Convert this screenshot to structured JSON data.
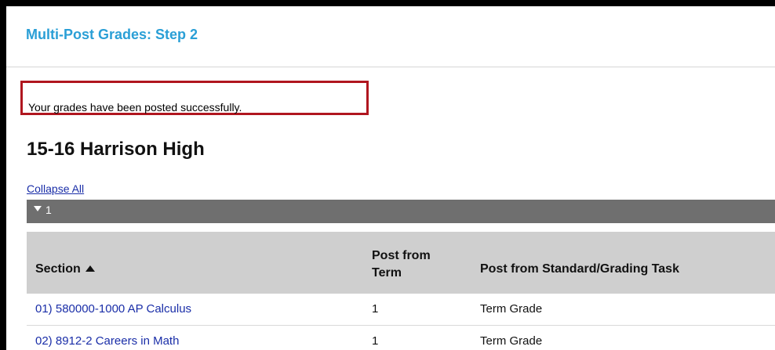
{
  "page": {
    "title": "Multi-Post Grades: Step 2",
    "success_message": "Your grades have been posted successfully.",
    "school_name": "15-16 Harrison High",
    "collapse_label": "Collapse All"
  },
  "group": {
    "label": "1",
    "icon": "triangle-down-icon"
  },
  "table": {
    "headers": {
      "section": "Section",
      "term_line1": "Post from",
      "term_line2": "Term",
      "task": "Post from Standard/Grading Task"
    },
    "sort_icon": "triangle-up-icon",
    "rows": [
      {
        "section": "01) 580000-1000 AP Calculus",
        "term": "1",
        "task": "Term Grade"
      },
      {
        "section": "02) 8912-2 Careers in Math",
        "term": "1",
        "task": "Term Grade"
      }
    ]
  },
  "colors": {
    "title": "#2a9fd6",
    "highlight_border": "#b0161f",
    "link": "#1a2ea8",
    "group_bar": "#6f6f6f",
    "table_header": "#cfcfcf"
  }
}
